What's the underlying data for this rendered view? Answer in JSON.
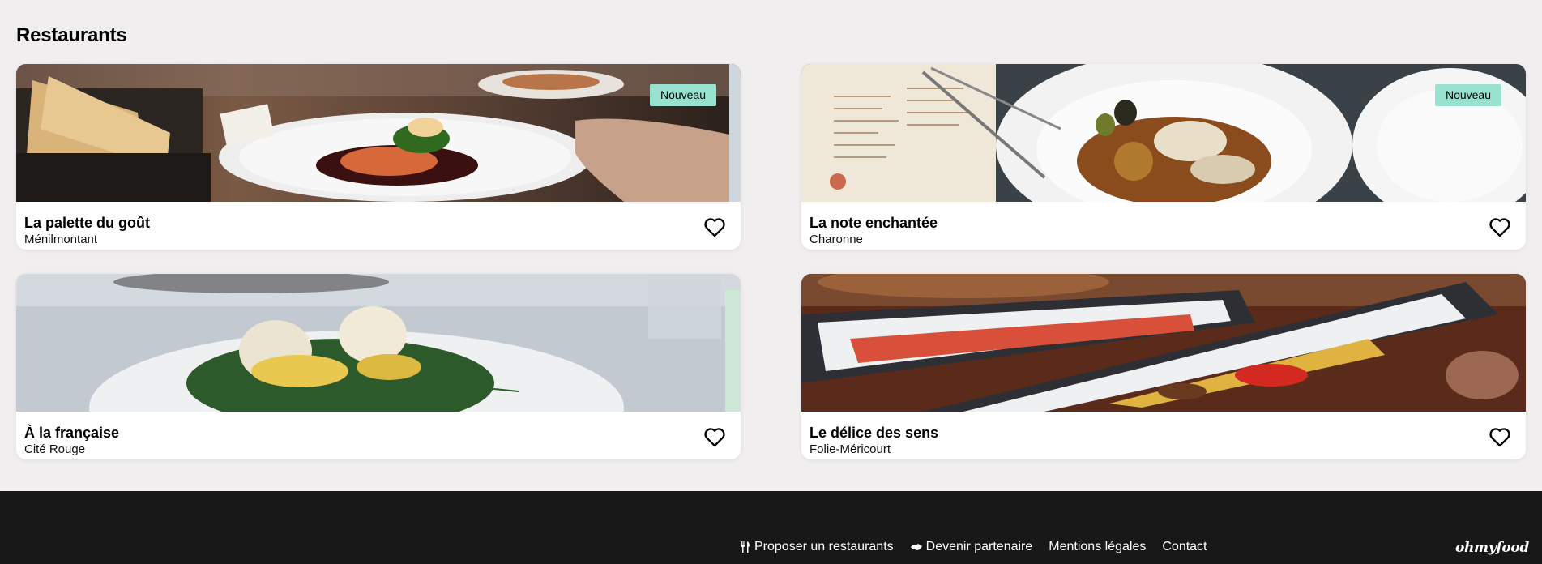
{
  "page": {
    "section_title": "Restaurants"
  },
  "restaurants": [
    {
      "name": "La palette du goût",
      "location": "Ménilmontant",
      "badge": "Nouveau",
      "icon": "heart-outline-icon"
    },
    {
      "name": "La note enchantée",
      "location": "Charonne",
      "badge": "Nouveau",
      "icon": "heart-outline-icon"
    },
    {
      "name": "À la française",
      "location": "Cité Rouge",
      "icon": "heart-outline-icon"
    },
    {
      "name": "Le délice des sens",
      "location": "Folie-Méricourt",
      "icon": "heart-outline-icon"
    }
  ],
  "footer": {
    "links": [
      {
        "label": "Proposer un restaurants",
        "icon": "utensils-icon"
      },
      {
        "label": "Devenir partenaire",
        "icon": "handshake-icon"
      },
      {
        "label": "Mentions légales"
      },
      {
        "label": "Contact"
      }
    ],
    "logo": "ohmyfood"
  },
  "colors": {
    "badge": "#99e2d0",
    "background": "#f0eeee",
    "footer": "#181818"
  }
}
